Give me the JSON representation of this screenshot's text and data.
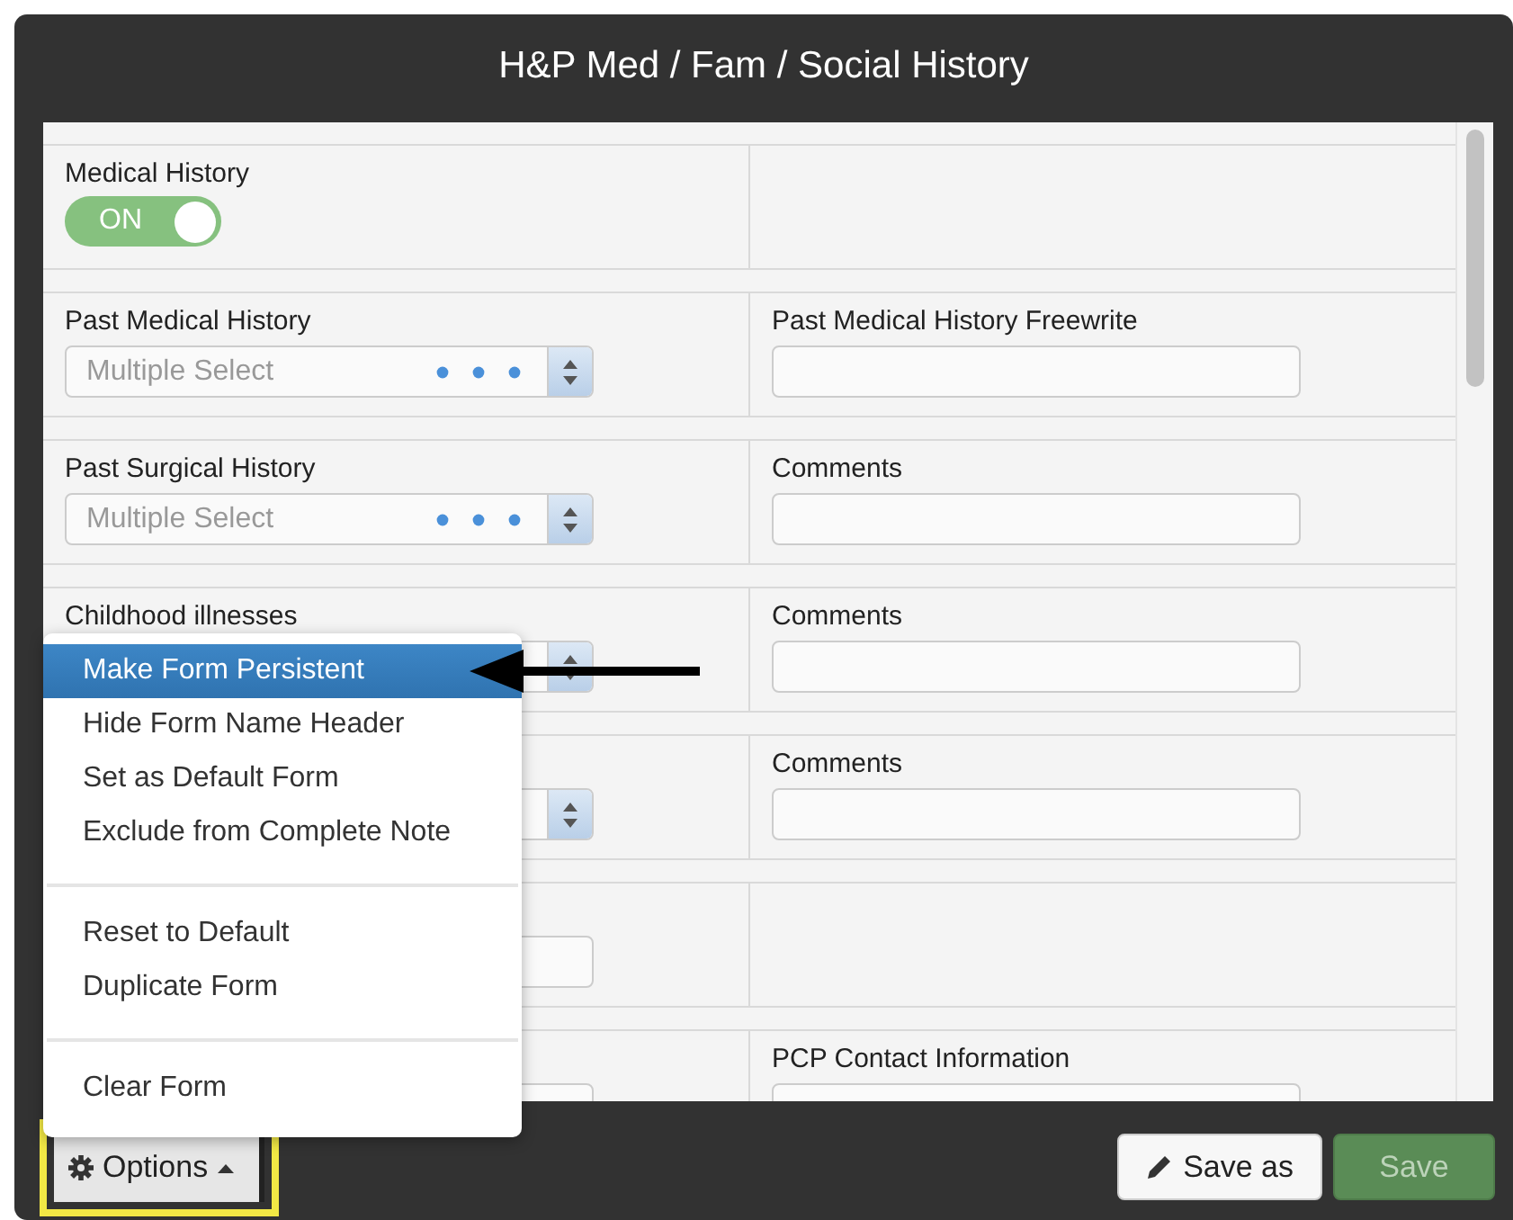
{
  "window": {
    "title": "H&P Med / Fam / Social History"
  },
  "form": {
    "rows": [
      {
        "cells": [
          {
            "kind": "toggle",
            "label": "Medical History",
            "on": true,
            "state_text": "ON"
          },
          {
            "kind": "empty"
          }
        ]
      },
      {
        "cells": [
          {
            "kind": "select",
            "label": "Past Medical History",
            "placeholder": "Multiple Select"
          },
          {
            "kind": "text",
            "label": "Past Medical History Freewrite"
          }
        ]
      },
      {
        "cells": [
          {
            "kind": "select",
            "label": "Past Surgical History",
            "placeholder": "Multiple Select"
          },
          {
            "kind": "text",
            "label": "Comments"
          }
        ]
      },
      {
        "cells": [
          {
            "kind": "select",
            "label": "Childhood illnesses"
          },
          {
            "kind": "text",
            "label": "Comments"
          }
        ]
      },
      {
        "cells": [
          {
            "kind": "select"
          },
          {
            "kind": "text",
            "label": "Comments"
          }
        ]
      },
      {
        "cells": [
          {
            "kind": "text"
          },
          {
            "kind": "empty"
          }
        ]
      },
      {
        "cells": [
          {
            "kind": "text"
          },
          {
            "kind": "text",
            "label": "PCP Contact Information"
          }
        ]
      }
    ]
  },
  "options_menu": {
    "groups": [
      {
        "items": [
          {
            "label": "Make Form Persistent",
            "selected": true
          },
          {
            "label": "Hide Form Name Header",
            "selected": false
          },
          {
            "label": "Set as Default Form",
            "selected": false
          },
          {
            "label": "Exclude from Complete Note",
            "selected": false
          }
        ]
      },
      {
        "items": [
          {
            "label": "Reset to Default",
            "selected": false
          },
          {
            "label": "Duplicate Form",
            "selected": false
          }
        ]
      },
      {
        "items": [
          {
            "label": "Clear Form",
            "selected": false
          }
        ]
      }
    ]
  },
  "footer": {
    "options_button": {
      "label": "Options",
      "highlighted": true
    },
    "buttons": [
      {
        "label": "Save as",
        "kind": "secondary",
        "disabled": false
      },
      {
        "label": "Save",
        "kind": "primary",
        "disabled": true
      }
    ]
  }
}
